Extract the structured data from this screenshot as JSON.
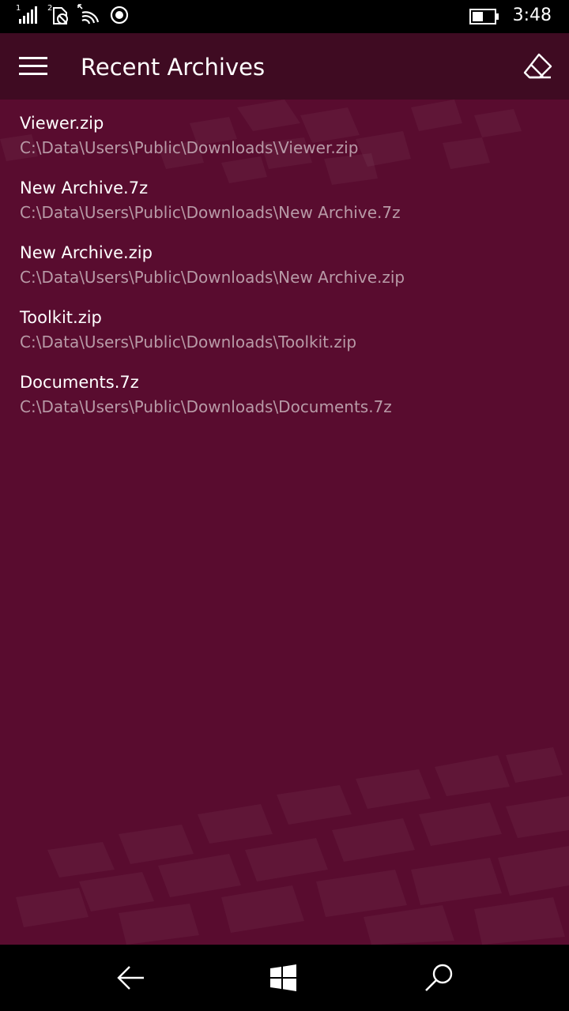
{
  "status_bar": {
    "sim1_label": "1",
    "sim2_label": "2",
    "time": "3:48",
    "icons": [
      "signal-icon",
      "sim2-no-signal-icon",
      "wifi-icon",
      "location-icon",
      "battery-icon"
    ]
  },
  "header": {
    "title": "Recent Archives",
    "menu_icon": "hamburger-icon",
    "clear_icon": "eraser-icon"
  },
  "archives": [
    {
      "name": "Viewer.zip",
      "path": "C:\\Data\\Users\\Public\\Downloads\\Viewer.zip"
    },
    {
      "name": "New Archive.7z",
      "path": "C:\\Data\\Users\\Public\\Downloads\\New Archive.7z"
    },
    {
      "name": "New Archive.zip",
      "path": "C:\\Data\\Users\\Public\\Downloads\\New Archive.zip"
    },
    {
      "name": "Toolkit.zip",
      "path": "C:\\Data\\Users\\Public\\Downloads\\Toolkit.zip"
    },
    {
      "name": "Documents.7z",
      "path": "C:\\Data\\Users\\Public\\Downloads\\Documents.7z"
    }
  ],
  "nav_bar": {
    "icons": [
      "back-arrow-icon",
      "windows-start-icon",
      "search-icon"
    ]
  },
  "colors": {
    "header_bg": "#3f0b22",
    "content_bg": "#590c2f",
    "path_text": "#b89aa7"
  }
}
